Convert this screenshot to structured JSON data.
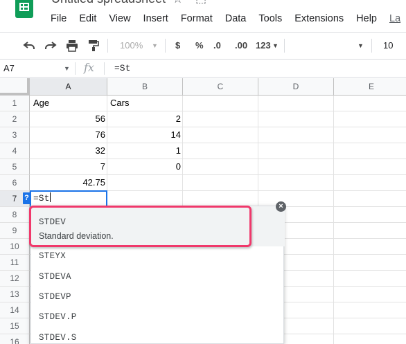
{
  "app": {
    "title": "Untitled spreadsheet",
    "brand_color": "#0f9d58",
    "accent_color": "#1a73e8",
    "highlight_color": "#f0386b"
  },
  "menu": [
    "File",
    "Edit",
    "View",
    "Insert",
    "Format",
    "Data",
    "Tools",
    "Extensions",
    "Help",
    "La"
  ],
  "toolbar": {
    "zoom": "100%",
    "currency": "$",
    "percent": "%",
    "decrease_decimals": ".0",
    "increase_decimals": ".00",
    "more_formats": "123",
    "font_size": "10",
    "icons": [
      "undo-icon",
      "redo-icon",
      "print-icon",
      "paint-format-icon"
    ]
  },
  "formula_bar": {
    "name_box": "A7",
    "fx": "fx",
    "formula": "=St"
  },
  "columns": [
    "A",
    "B",
    "C",
    "D",
    "E"
  ],
  "rows": [
    "1",
    "2",
    "3",
    "4",
    "5",
    "6",
    "7",
    "8",
    "9",
    "10",
    "11",
    "12",
    "13",
    "14",
    "15",
    "16"
  ],
  "cells": {
    "A1": "Age",
    "B1": "Cars",
    "A2": "56",
    "B2": "2",
    "A3": "76",
    "B3": "14",
    "A4": "32",
    "B4": "1",
    "A5": "7",
    "B5": "0",
    "A6": "42.75"
  },
  "active_cell": {
    "ref": "A7",
    "value": "=St",
    "help_badge": "?"
  },
  "autocomplete": {
    "selected": {
      "name": "STDEV",
      "description": "Standard deviation."
    },
    "suggestions": [
      "STEYX",
      "STDEVA",
      "STDEVP",
      "STDEV.P",
      "STDEV.S"
    ],
    "close_glyph": "×"
  }
}
